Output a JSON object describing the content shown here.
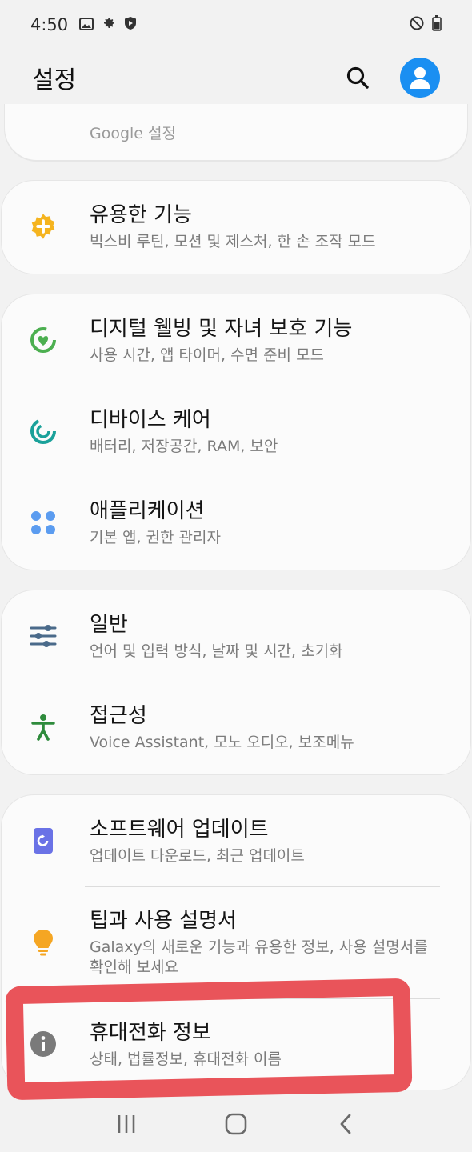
{
  "status_bar": {
    "time": "4:50",
    "left_icons": [
      "image-icon",
      "gear-icon",
      "shield-icon"
    ],
    "right_icons": [
      "do-not-disturb-icon",
      "battery-icon"
    ]
  },
  "header": {
    "title": "설정"
  },
  "partial_item": {
    "sub": "Google 설정"
  },
  "groups": [
    {
      "items": [
        {
          "label": "유용한 기능",
          "sub": "빅스비 루틴, 모션 및 제스처, 한 손 조작 모드",
          "icon": "advanced-features-icon",
          "color": "#f5b41f"
        }
      ]
    },
    {
      "items": [
        {
          "label": "디지털 웰빙 및 자녀 보호 기능",
          "sub": "사용 시간, 앱 타이머, 수면 준비 모드",
          "icon": "digital-wellbeing-icon",
          "color": "#4caf50"
        },
        {
          "label": "디바이스 케어",
          "sub": "배터리, 저장공간, RAM, 보안",
          "icon": "device-care-icon",
          "color": "#1aa19a"
        },
        {
          "label": "애플리케이션",
          "sub": "기본 앱, 권한 관리자",
          "icon": "apps-icon",
          "color": "#5b9cf0"
        }
      ]
    },
    {
      "items": [
        {
          "label": "일반",
          "sub": "언어 및 입력 방식, 날짜 및 시간, 초기화",
          "icon": "general-management-icon",
          "color": "#4a6a8a"
        },
        {
          "label": "접근성",
          "sub": "Voice Assistant, 모노 오디오, 보조메뉴",
          "icon": "accessibility-icon",
          "color": "#2e8b3c"
        }
      ]
    },
    {
      "items": [
        {
          "label": "소프트웨어 업데이트",
          "sub": "업데이트 다운로드, 최근 업데이트",
          "icon": "software-update-icon",
          "color": "#6a72e6"
        },
        {
          "label": "팁과 사용 설명서",
          "sub": "Galaxy의 새로운 기능과 유용한 정보, 사용 설명서를 확인해 보세요",
          "icon": "lightbulb-icon",
          "color": "#f5a623"
        },
        {
          "label": "휴대전화 정보",
          "sub": "상태, 법률정보, 휴대전화 이름",
          "icon": "info-icon",
          "color": "#8a8a8a"
        }
      ]
    }
  ],
  "navbar": {
    "buttons": [
      "recents-icon",
      "home-icon",
      "back-icon"
    ]
  },
  "colors": {
    "highlight": "#e9545a",
    "accent": "#1a8ff2"
  }
}
